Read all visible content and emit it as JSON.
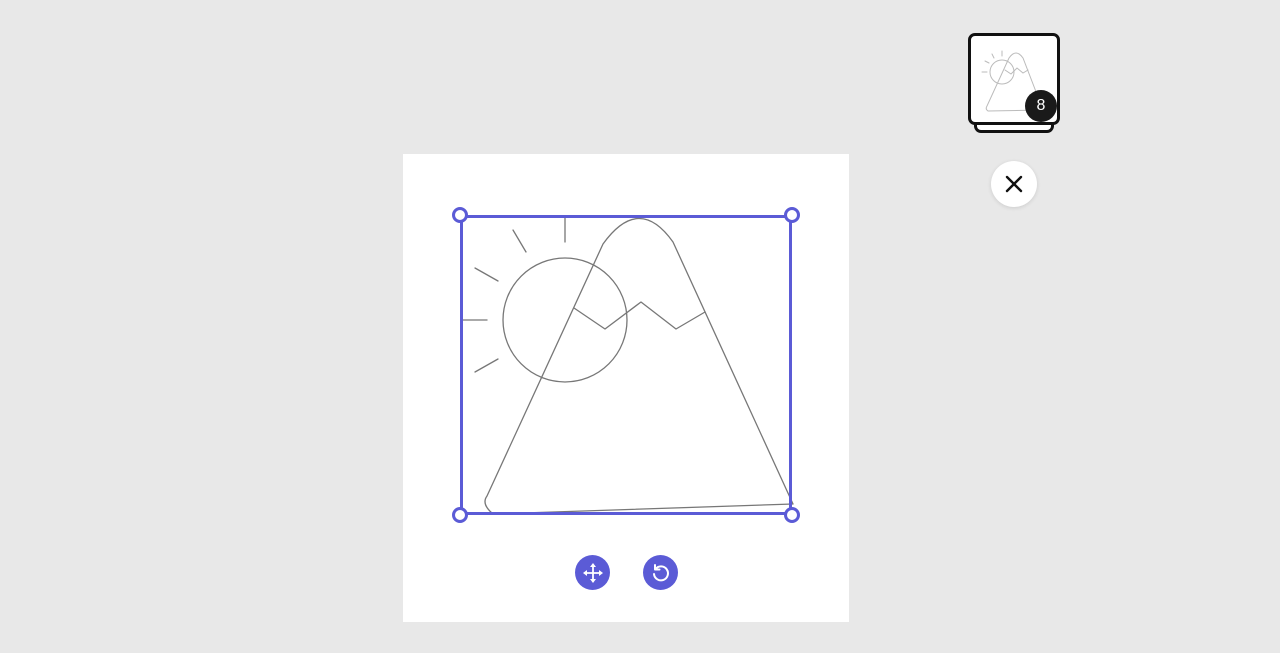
{
  "editor": {
    "accent_color": "#5b5bd6",
    "background_color": "#e8e8e8",
    "canvas_color": "#ffffff",
    "drawing": {
      "description_icon": "sun-and-mountain-sketch",
      "stroke_color": "#777777"
    },
    "tools": {
      "move_icon": "move-arrows-icon",
      "rotate_icon": "rotate-icon"
    }
  },
  "sidebar": {
    "image_stack": {
      "count": "8",
      "thumbnail_icon": "sun-and-mountain-thumbnail"
    },
    "close_icon": "close-icon"
  }
}
